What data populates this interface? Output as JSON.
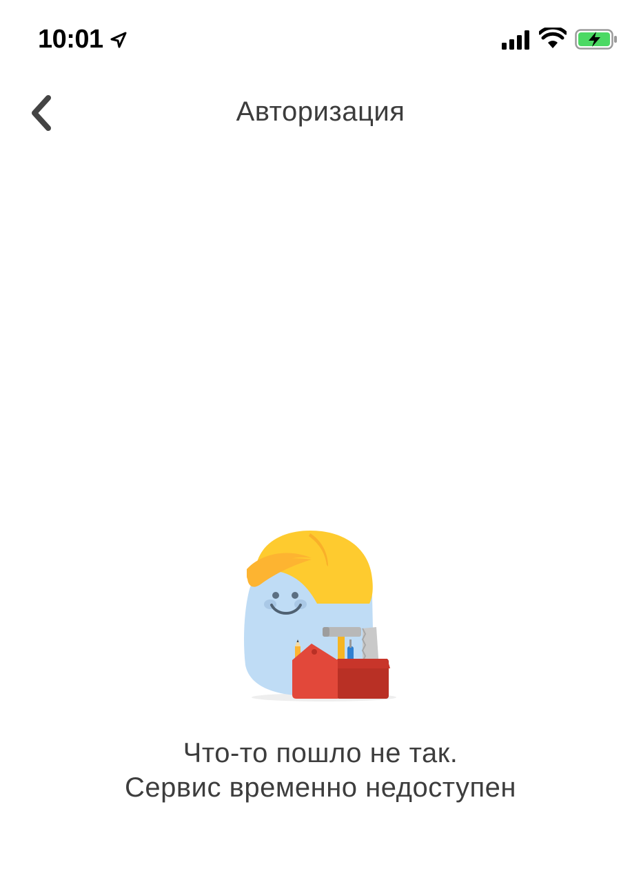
{
  "status_bar": {
    "time": "10:01",
    "icons": [
      "location-arrow-icon",
      "cellular-signal-icon",
      "wifi-icon",
      "battery-charging-icon"
    ],
    "battery_color": "#4cd964"
  },
  "nav": {
    "back_icon": "chevron-left-icon",
    "title": "Авторизация"
  },
  "error": {
    "illustration": "construction-worker-toolbox-illustration",
    "line1": "Что-то пошло не так.",
    "line2": "Сервис временно недоступен"
  },
  "colors": {
    "background": "#ffffff",
    "title_text": "#3c3c3c",
    "helmet": "#fecb2f",
    "character": "#bfdcf5",
    "toolbox": "#e2483a"
  }
}
